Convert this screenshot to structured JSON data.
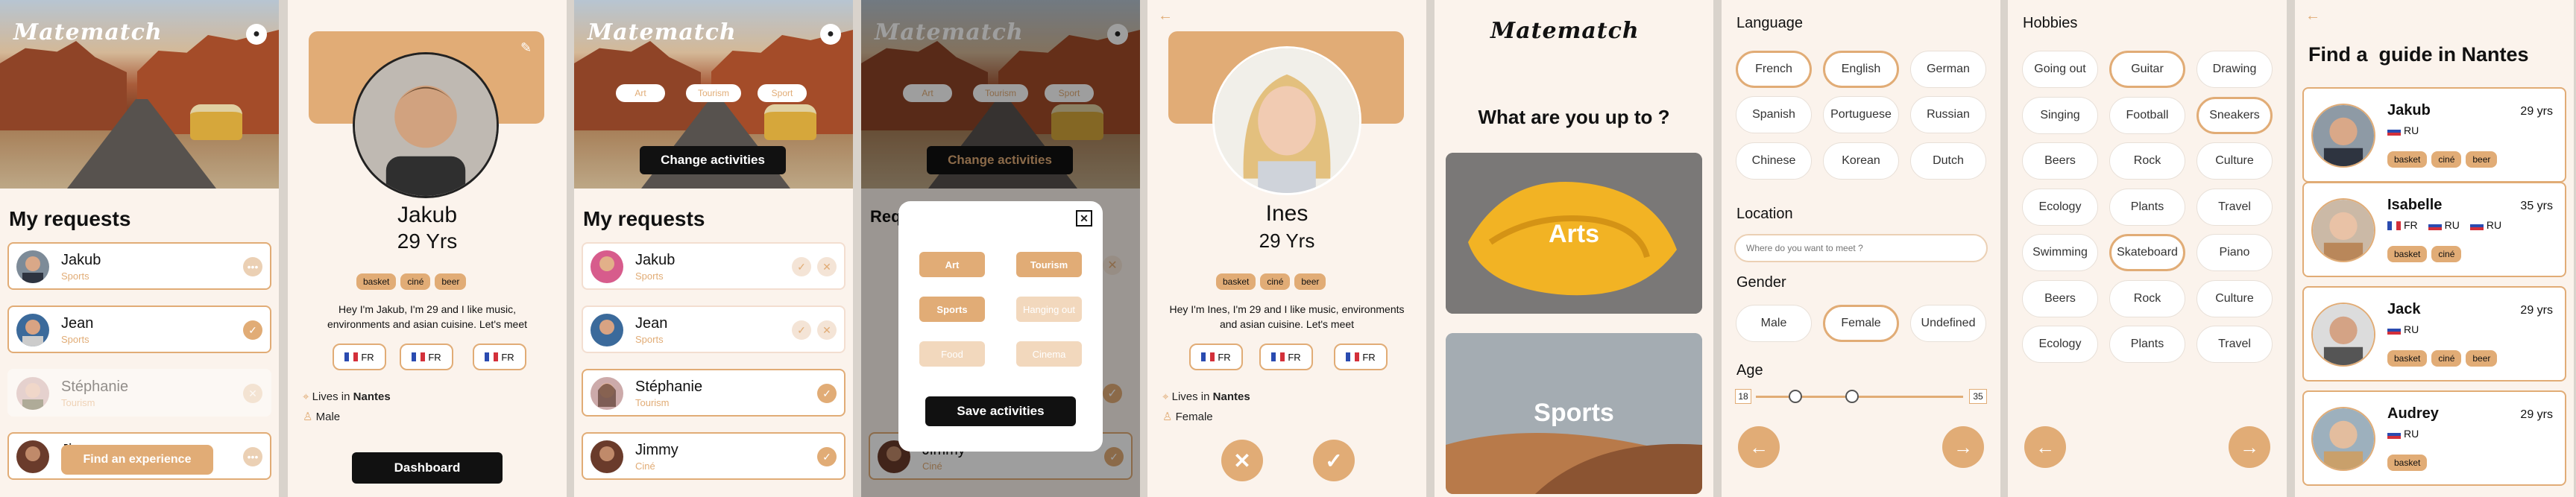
{
  "brand": {
    "name": "Matematch",
    "accent": "#e1ac76",
    "dark": "#111111"
  },
  "s1": {
    "title": "My requests",
    "cta": "Find  an experience",
    "items": [
      {
        "name": "Jakub",
        "activity": "Sports",
        "action": "more"
      },
      {
        "name": "Jean",
        "activity": "Sports",
        "action": "accepted"
      },
      {
        "name": "Stéphanie",
        "activity": "Tourism",
        "action": "declined"
      },
      {
        "name": "Ji",
        "activity": "",
        "action": "more"
      }
    ]
  },
  "s2": {
    "name": "Jakub",
    "age": "29 Yrs",
    "tags": [
      "basket",
      "ciné",
      "beer"
    ],
    "bio": "Hey I'm Jakub, I'm 29 and I like music, environments and asian cuisine. Let's meet",
    "langs": [
      "FR",
      "FR",
      "FR"
    ],
    "lives_prefix": "Lives in",
    "city": "Nantes",
    "gender": "Male",
    "button": "Dashboard",
    "edit_icon": "pencil-icon"
  },
  "s3": {
    "filters": [
      "Art",
      "Tourism",
      "Sport"
    ],
    "change": "Change activities",
    "title": "My requests",
    "items": [
      {
        "name": "Jakub",
        "activity": "Sports"
      },
      {
        "name": "Jean",
        "activity": "Sports"
      },
      {
        "name": "Stéphanie",
        "activity": "Tourism"
      },
      {
        "name": "Jimmy",
        "activity": "Ciné"
      }
    ]
  },
  "s4": {
    "filters": [
      "Art",
      "Tourism",
      "Sport"
    ],
    "change": "Change activities",
    "title_partial": "Req",
    "modal": {
      "options": [
        {
          "label": "Art",
          "state": "on"
        },
        {
          "label": "Tourism",
          "state": "on"
        },
        {
          "label": "Sports",
          "state": "on"
        },
        {
          "label": "Hanging out",
          "state": "off"
        },
        {
          "label": "Food",
          "state": "off"
        },
        {
          "label": "Cinema",
          "state": "off"
        }
      ],
      "save": "Save activities"
    },
    "bottom_name": "Jimmy",
    "bottom_activity": "Ciné"
  },
  "s5": {
    "name": "Ines",
    "age": "29 Yrs",
    "tags": [
      "basket",
      "ciné",
      "beer"
    ],
    "bio": "Hey I'm Ines, I'm 29 and I like music, environments and asian cuisine. Let's meet",
    "langs": [
      "FR",
      "FR",
      "FR"
    ],
    "lives_prefix": "Lives in",
    "city": "Nantes",
    "gender": "Female"
  },
  "s6": {
    "question": "What are you up to ?",
    "cards": [
      "Arts",
      "Sports"
    ]
  },
  "s7": {
    "language_label": "Language",
    "languages": [
      {
        "label": "French",
        "on": true
      },
      {
        "label": "English",
        "on": true
      },
      {
        "label": "German",
        "on": false
      },
      {
        "label": "Spanish",
        "on": false
      },
      {
        "label": "Portuguese",
        "on": false
      },
      {
        "label": "Russian",
        "on": false
      },
      {
        "label": "Chinese",
        "on": false
      },
      {
        "label": "Korean",
        "on": false
      },
      {
        "label": "Dutch",
        "on": false
      }
    ],
    "location_label": "Location",
    "location_placeholder": "Where do you want to meet ?",
    "gender_label": "Gender",
    "genders": [
      {
        "label": "Male",
        "on": false
      },
      {
        "label": "Female",
        "on": true
      },
      {
        "label": "Undefined",
        "on": false
      }
    ],
    "age_label": "Age",
    "age_min": "18",
    "age_max": "35"
  },
  "s8": {
    "label": "Hobbies",
    "hobbies": [
      {
        "label": "Going out",
        "on": false
      },
      {
        "label": "Guitar",
        "on": true
      },
      {
        "label": "Drawing",
        "on": false
      },
      {
        "label": "Singing",
        "on": false
      },
      {
        "label": "Football",
        "on": false
      },
      {
        "label": "Sneakers",
        "on": true
      },
      {
        "label": "Beers",
        "on": false
      },
      {
        "label": "Rock",
        "on": false
      },
      {
        "label": "Culture",
        "on": false
      },
      {
        "label": "Ecology",
        "on": false
      },
      {
        "label": "Plants",
        "on": false
      },
      {
        "label": "Travel",
        "on": false
      },
      {
        "label": "Swimming",
        "on": false
      },
      {
        "label": "Skateboard",
        "on": true
      },
      {
        "label": "Piano",
        "on": false
      },
      {
        "label": "Beers",
        "on": false
      },
      {
        "label": "Rock",
        "on": false
      },
      {
        "label": "Culture",
        "on": false
      },
      {
        "label": "Ecology",
        "on": false
      },
      {
        "label": "Plants",
        "on": false
      },
      {
        "label": "Travel",
        "on": false
      }
    ]
  },
  "s9": {
    "title": "Find a  guide in Nantes",
    "guides": [
      {
        "name": "Jakub",
        "age": "29 yrs",
        "langs": [
          "RU"
        ],
        "tags": [
          "basket",
          "ciné",
          "beer"
        ]
      },
      {
        "name": "Isabelle",
        "age": "35 yrs",
        "langs": [
          "FR",
          "RU",
          "RU"
        ],
        "tags": [
          "basket",
          "ciné"
        ]
      },
      {
        "name": "Jack",
        "age": "29 yrs",
        "langs": [
          "RU"
        ],
        "tags": [
          "basket",
          "ciné",
          "beer"
        ]
      },
      {
        "name": "Audrey",
        "age": "29 yrs",
        "langs": [
          "RU"
        ],
        "tags": [
          "basket"
        ]
      }
    ]
  }
}
